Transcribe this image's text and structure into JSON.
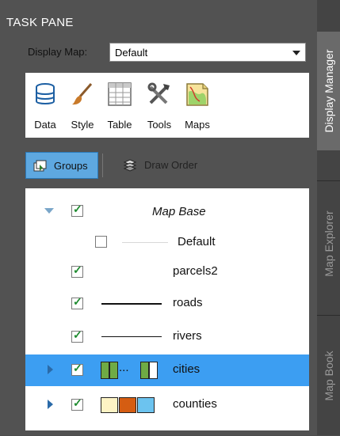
{
  "pane": {
    "title": "TASK PANE"
  },
  "display_map": {
    "label": "Display Map:",
    "value": "Default"
  },
  "tools": [
    {
      "label": "Data",
      "icon": "database-icon"
    },
    {
      "label": "Style",
      "icon": "brush-icon"
    },
    {
      "label": "Table",
      "icon": "table-icon"
    },
    {
      "label": "Tools",
      "icon": "tools-icon"
    },
    {
      "label": "Maps",
      "icon": "map-icon"
    }
  ],
  "tabs": {
    "groups": "Groups",
    "draw_order": "Draw Order"
  },
  "layers": [
    {
      "name": "Map Base",
      "checked": true,
      "expanded": true
    },
    {
      "name": "Default",
      "checked": false
    },
    {
      "name": "parcels2",
      "checked": true
    },
    {
      "name": "roads",
      "checked": true
    },
    {
      "name": "rivers",
      "checked": true
    },
    {
      "name": "cities",
      "checked": true,
      "selected": true
    },
    {
      "name": "counties",
      "checked": true
    }
  ],
  "side_tabs": [
    "Display Manager",
    "Map Explorer",
    "Map Book"
  ],
  "colors": {
    "selection": "#3c9ef2",
    "check": "#1e8b2f",
    "counties_fill_1": "#fdf3c4",
    "counties_fill_2": "#d55d12",
    "counties_fill_3": "#6cc3ef",
    "cities_fill": "#6fab45"
  }
}
